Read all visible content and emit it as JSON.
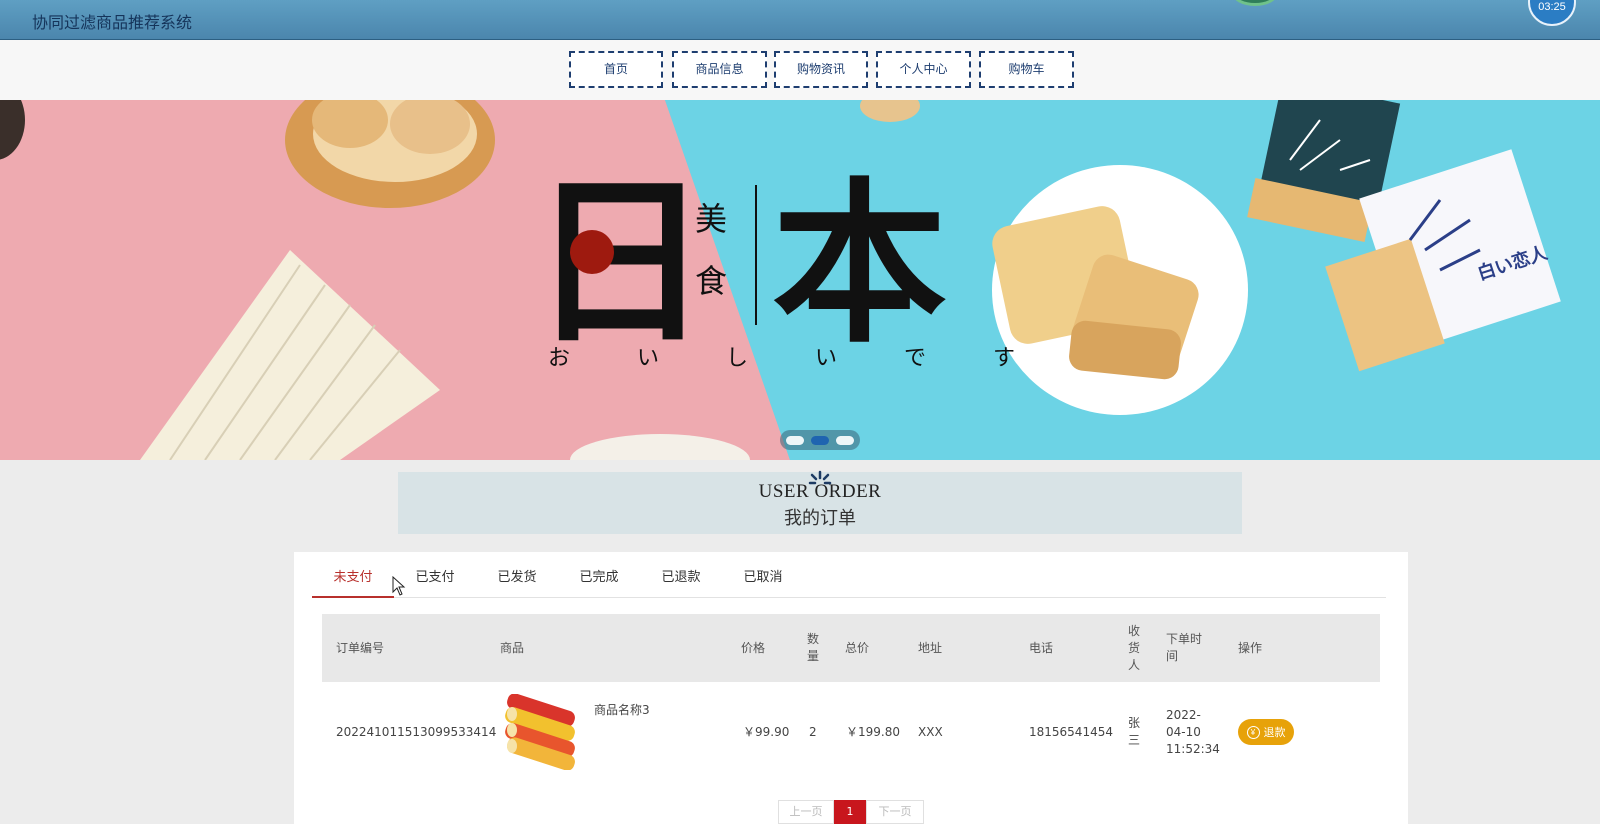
{
  "app": {
    "title": "协同过滤商品推荐系统",
    "clock": "03:25"
  },
  "nav": {
    "items": [
      {
        "label": "首页"
      },
      {
        "label": "商品信息"
      },
      {
        "label": "购物资讯"
      },
      {
        "label": "个人中心"
      },
      {
        "label": "购物车"
      }
    ]
  },
  "banner": {
    "big_left": "日",
    "big_right": "本",
    "small_top": "美",
    "small_bottom": "食",
    "kana": "お い し い で す",
    "package_text": "白い恋人",
    "active_slide": 2,
    "slide_count": 3
  },
  "section": {
    "title_en": "USER ORDER",
    "title_cn": "我的订单"
  },
  "tabs": [
    {
      "label": "未支付",
      "active": true
    },
    {
      "label": "已支付"
    },
    {
      "label": "已发货"
    },
    {
      "label": "已完成"
    },
    {
      "label": "已退款"
    },
    {
      "label": "已取消"
    }
  ],
  "table": {
    "headers": {
      "order_no": "订单编号",
      "product": "商品",
      "price": "价格",
      "qty": "数量",
      "total": "总价",
      "address": "地址",
      "phone": "电话",
      "receiver": "收货人",
      "order_time": "下单时间",
      "action": "操作"
    },
    "rows": [
      {
        "order_no": "202241011513099533414",
        "product_name": "商品名称3",
        "price": "￥99.90",
        "qty": "2",
        "total": "￥199.80",
        "address": "XXX",
        "phone": "18156541454",
        "receiver": "张三",
        "order_time": "2022-04-10 11:52:34",
        "action": "退款"
      }
    ]
  },
  "pagination": {
    "prev": "上一页",
    "current": "1",
    "next": "下一页"
  },
  "colors": {
    "accent_red": "#b8302c",
    "refund_orange": "#e7a20a",
    "nav_border": "#1e3e70"
  }
}
